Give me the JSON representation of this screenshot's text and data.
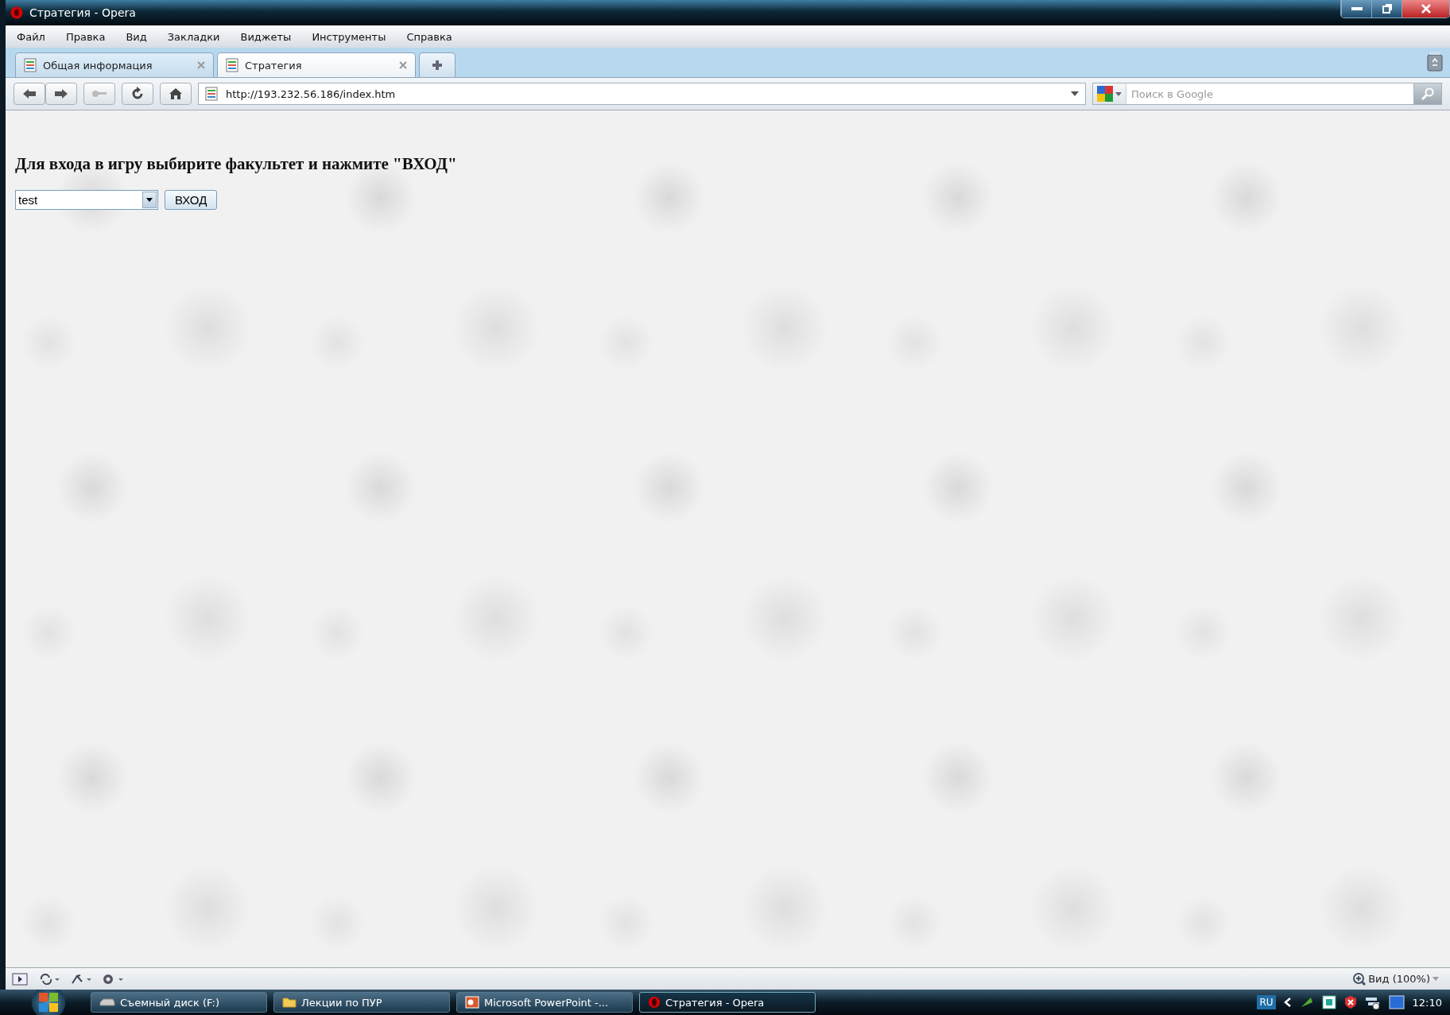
{
  "window": {
    "title": "Стратегия - Opera"
  },
  "menu": [
    "Файл",
    "Правка",
    "Вид",
    "Закладки",
    "Виджеты",
    "Инструменты",
    "Справка"
  ],
  "tabs": [
    {
      "label": "Общая информация",
      "selected": false
    },
    {
      "label": "Стратегия",
      "selected": true
    }
  ],
  "address": {
    "value": "http://193.232.56.186/index.htm"
  },
  "search": {
    "placeholder": "Поиск в Google"
  },
  "page": {
    "heading": "Для входа в игру выбирите факультет и нажмите \"ВХОД\"",
    "select_value": "test",
    "button": "ВХОД"
  },
  "status_bar": {
    "zoom": "Вид (100%)"
  },
  "taskbar": {
    "items": [
      {
        "label": "Съемный диск (F:)",
        "kind": "drive",
        "selected": false
      },
      {
        "label": "Лекции по ПУР",
        "kind": "folder",
        "selected": false
      },
      {
        "label": "Microsoft PowerPoint -...",
        "kind": "powerpoint",
        "selected": false
      },
      {
        "label": "Стратегия - Opera",
        "kind": "opera",
        "selected": true
      }
    ],
    "language": "RU",
    "clock": "12:10"
  }
}
